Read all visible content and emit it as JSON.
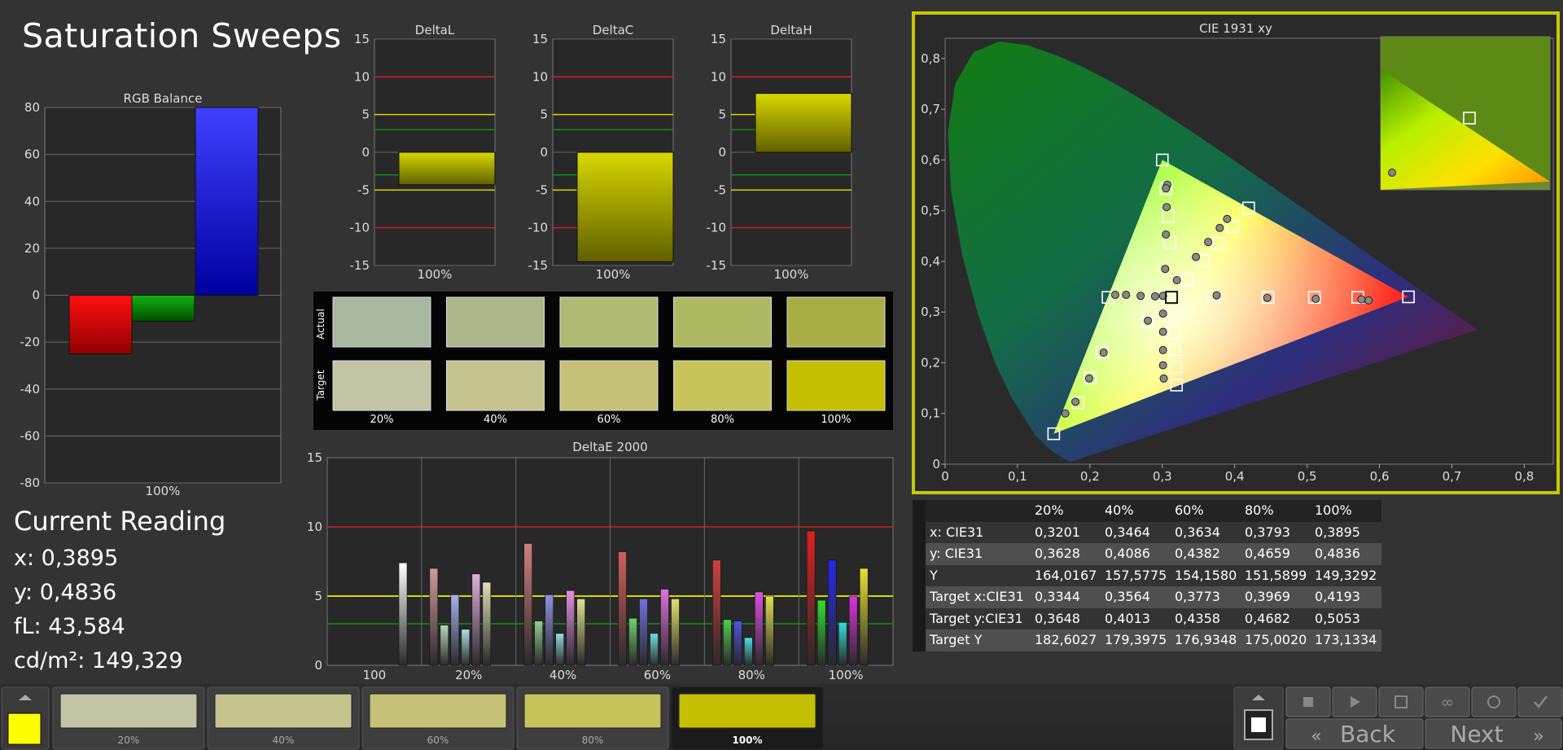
{
  "app": {
    "title": "Saturation Sweeps"
  },
  "colors": {
    "accent": "#c8c800",
    "bg": "#333333",
    "panel": "#282828",
    "grid": "#6e6e6e",
    "red_line": "#d02020",
    "yellow_line": "#d8d800",
    "green_line": "#109010"
  },
  "rgb_balance": {
    "title": "RGB Balance",
    "category": "100%",
    "ticks": [
      "80",
      "60",
      "40",
      "20",
      "0",
      "-20",
      "-40",
      "-60",
      "-80"
    ],
    "ylim": [
      -80,
      80
    ],
    "values": {
      "red": -25,
      "green": -11,
      "blue": 80
    }
  },
  "delta_charts": [
    {
      "title": "DeltaL",
      "category": "100%",
      "value": -4.3
    },
    {
      "title": "DeltaC",
      "category": "100%",
      "value": -14.5
    },
    {
      "title": "DeltaH",
      "category": "100%",
      "value": 7.8
    }
  ],
  "delta_ticks": [
    "15",
    "10",
    "5",
    "0",
    "-5",
    "-10",
    "-15"
  ],
  "swatches": {
    "row_labels": [
      "Actual",
      "Target"
    ],
    "labels": [
      "20%",
      "40%",
      "60%",
      "80%",
      "100%"
    ],
    "actual": [
      "#a8b8a0",
      "#abb78a",
      "#b0ba72",
      "#afb963",
      "#a8ae46"
    ],
    "target": [
      "#c3c3a6",
      "#c5c38e",
      "#c5c277",
      "#c6c45a",
      "#c4c000"
    ]
  },
  "deltae": {
    "title": "DeltaE 2000",
    "ticks": [
      "15",
      "10",
      "5",
      "0"
    ],
    "ylim": [
      0,
      15
    ],
    "categories": [
      "100",
      "20%",
      "40%",
      "60%",
      "80%",
      "100%"
    ],
    "groups": [
      [
        {
          "color": "#ffffff",
          "value": 7.4
        }
      ],
      [
        {
          "color": "#d09a9a",
          "value": 7.0
        },
        {
          "color": "#b8d8b8",
          "value": 2.9
        },
        {
          "color": "#aab0ee",
          "value": 5.1
        },
        {
          "color": "#b0e0e0",
          "value": 2.6
        },
        {
          "color": "#e0b0e0",
          "value": 6.6
        },
        {
          "color": "#e0e0b8",
          "value": 6.0
        }
      ],
      [
        {
          "color": "#d08080",
          "value": 8.8
        },
        {
          "color": "#90d090",
          "value": 3.2
        },
        {
          "color": "#9090e0",
          "value": 5.1
        },
        {
          "color": "#90e0e0",
          "value": 2.3
        },
        {
          "color": "#e090e0",
          "value": 5.4
        },
        {
          "color": "#e0e090",
          "value": 4.8
        }
      ],
      [
        {
          "color": "#d06060",
          "value": 8.2
        },
        {
          "color": "#70d070",
          "value": 3.4
        },
        {
          "color": "#7070e0",
          "value": 4.8
        },
        {
          "color": "#70e0e0",
          "value": 2.3
        },
        {
          "color": "#e070e0",
          "value": 5.5
        },
        {
          "color": "#e0e070",
          "value": 4.8
        }
      ],
      [
        {
          "color": "#d04040",
          "value": 7.6
        },
        {
          "color": "#50d050",
          "value": 3.3
        },
        {
          "color": "#5050e0",
          "value": 3.2
        },
        {
          "color": "#50e0e0",
          "value": 2.0
        },
        {
          "color": "#e050e0",
          "value": 5.3
        },
        {
          "color": "#e0e050",
          "value": 5.0
        }
      ],
      [
        {
          "color": "#e02020",
          "value": 9.7
        },
        {
          "color": "#30e030",
          "value": 4.7
        },
        {
          "color": "#2828e8",
          "value": 7.6
        },
        {
          "color": "#30e0e0",
          "value": 3.1
        },
        {
          "color": "#e030e0",
          "value": 5.0
        },
        {
          "color": "#e8e030",
          "value": 7.0
        }
      ]
    ]
  },
  "cie": {
    "title": "CIE 1931 xy",
    "xticks": [
      "0",
      "0,1",
      "0,2",
      "0,3",
      "0,4",
      "0,5",
      "0,6",
      "0,7",
      "0,8"
    ],
    "yticks": [
      "0",
      "0,1",
      "0,2",
      "0,3",
      "0,4",
      "0,5",
      "0,6",
      "0,7",
      "0,8"
    ],
    "xlim": [
      0,
      0.84
    ],
    "ylim": [
      0,
      0.84
    ],
    "gamut": [
      [
        0.64,
        0.33
      ],
      [
        0.3,
        0.6
      ],
      [
        0.15,
        0.06
      ]
    ],
    "white": [
      0.3127,
      0.329
    ],
    "targets": [
      [
        0.15,
        0.06
      ],
      [
        0.1836,
        0.1208
      ],
      [
        0.2005,
        0.1703
      ],
      [
        0.2169,
        0.221
      ],
      [
        0.3,
        0.6
      ],
      [
        0.305,
        0.543
      ],
      [
        0.3083,
        0.4887
      ],
      [
        0.3107,
        0.437
      ],
      [
        0.3127,
        0.329
      ],
      [
        0.3196,
        0.156
      ],
      [
        0.3183,
        0.1915
      ],
      [
        0.317,
        0.2258
      ],
      [
        0.3156,
        0.2598
      ],
      [
        0.3141,
        0.2943
      ],
      [
        0.3715,
        0.329
      ],
      [
        0.446,
        0.329
      ],
      [
        0.51,
        0.329
      ],
      [
        0.57,
        0.329
      ],
      [
        0.64,
        0.33
      ],
      [
        0.225,
        0.329
      ],
      [
        0.28,
        0.28
      ],
      [
        0.3344,
        0.3648
      ],
      [
        0.3564,
        0.4013
      ],
      [
        0.3773,
        0.4358
      ],
      [
        0.3969,
        0.4682
      ],
      [
        0.4193,
        0.5053
      ]
    ],
    "measured": [
      [
        0.166,
        0.1
      ],
      [
        0.18,
        0.123
      ],
      [
        0.199,
        0.169
      ],
      [
        0.219,
        0.22
      ],
      [
        0.307,
        0.551
      ],
      [
        0.305,
        0.544
      ],
      [
        0.306,
        0.507
      ],
      [
        0.305,
        0.453
      ],
      [
        0.304,
        0.385
      ],
      [
        0.302,
        0.169
      ],
      [
        0.301,
        0.195
      ],
      [
        0.301,
        0.225
      ],
      [
        0.301,
        0.261
      ],
      [
        0.301,
        0.297
      ],
      [
        0.301,
        0.332
      ],
      [
        0.375,
        0.333
      ],
      [
        0.445,
        0.328
      ],
      [
        0.512,
        0.326
      ],
      [
        0.575,
        0.325
      ],
      [
        0.585,
        0.323
      ],
      [
        0.235,
        0.334
      ],
      [
        0.25,
        0.334
      ],
      [
        0.27,
        0.332
      ],
      [
        0.29,
        0.331
      ],
      [
        0.28,
        0.283
      ],
      [
        0.3201,
        0.3628
      ],
      [
        0.3464,
        0.4086
      ],
      [
        0.3634,
        0.4382
      ],
      [
        0.3793,
        0.4659
      ],
      [
        0.3895,
        0.4836
      ]
    ]
  },
  "current_reading": {
    "title": "Current Reading",
    "x": "x: 0,3895",
    "y": "y: 0,4836",
    "fl": "fL: 43,584",
    "cdm2": "cd/m²: 149,329"
  },
  "reading_table": {
    "columns": [
      "20%",
      "40%",
      "60%",
      "80%",
      "100%"
    ],
    "rows": [
      {
        "label": "x: CIE31",
        "values": [
          "0,3201",
          "0,3464",
          "0,3634",
          "0,3793",
          "0,3895"
        ]
      },
      {
        "label": "y: CIE31",
        "values": [
          "0,3628",
          "0,4086",
          "0,4382",
          "0,4659",
          "0,4836"
        ]
      },
      {
        "label": "Y",
        "values": [
          "164,0167",
          "157,5775",
          "154,1580",
          "151,5899",
          "149,3292"
        ]
      },
      {
        "label": "Target x:CIE31",
        "values": [
          "0,3344",
          "0,3564",
          "0,3773",
          "0,3969",
          "0,4193"
        ]
      },
      {
        "label": "Target y:CIE31",
        "values": [
          "0,3648",
          "0,4013",
          "0,4358",
          "0,4682",
          "0,5053"
        ]
      },
      {
        "label": "Target Y",
        "values": [
          "182,6027",
          "179,3975",
          "176,9348",
          "175,0020",
          "173,1334"
        ]
      }
    ]
  },
  "bottom": {
    "current_color": "#ffff00",
    "patches": [
      {
        "label": "20%",
        "color": "#c3c3a6"
      },
      {
        "label": "40%",
        "color": "#c5c38e"
      },
      {
        "label": "60%",
        "color": "#c5c277"
      },
      {
        "label": "80%",
        "color": "#c6c45a"
      },
      {
        "label": "100%",
        "color": "#c4c000",
        "selected": true
      }
    ],
    "back_label": "Back",
    "next_label": "Next"
  }
}
